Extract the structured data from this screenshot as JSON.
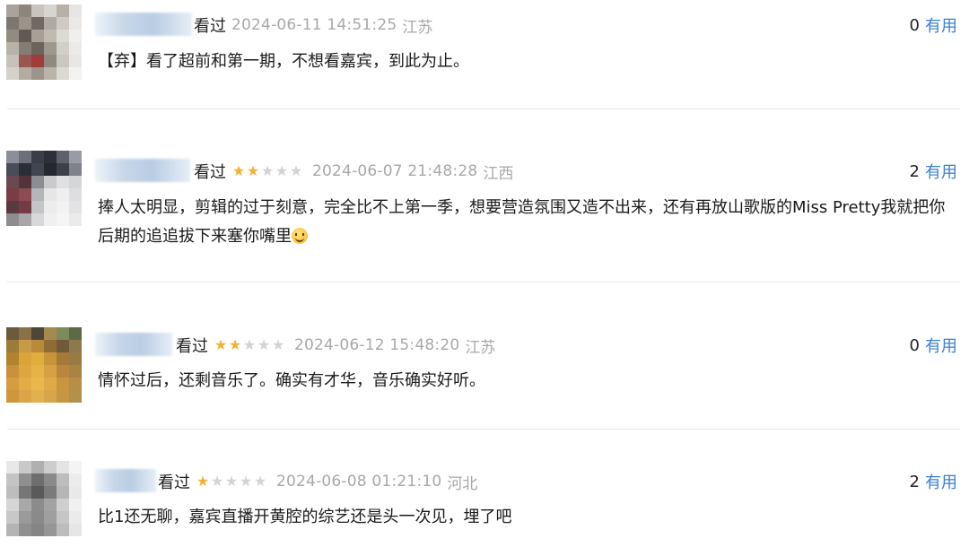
{
  "comments": [
    {
      "status": "看过",
      "rating": 0,
      "time": "2024-06-11 14:51:25",
      "location": "江苏",
      "useful_count": "0",
      "useful_label": "有用",
      "text": "【弃】看了超前和第一期，不想看嘉宾，到此为止。"
    },
    {
      "status": "看过",
      "rating": 2,
      "time": "2024-06-07 21:48:28",
      "location": "江西",
      "useful_count": "2",
      "useful_label": "有用",
      "text": "捧人太明显，剪辑的过于刻意，完全比不上第一季，想要营造氛围又造不出来，还有再放山歌版的Miss Pretty我就把你后期的追追拔下来塞你嘴里"
    },
    {
      "status": "看过",
      "rating": 2,
      "time": "2024-06-12 15:48:20",
      "location": "江苏",
      "useful_count": "0",
      "useful_label": "有用",
      "text": "情怀过后，还剩音乐了。确实有才华，音乐确实好听。"
    },
    {
      "status": "看过",
      "rating": 1,
      "time": "2024-06-08 01:21:10",
      "location": "河北",
      "useful_count": "2",
      "useful_label": "有用",
      "text": "比1还无聊，嘉宾直播开黄腔的综艺还是头一次见，埋了吧"
    }
  ],
  "colors": {
    "star_on": "#f2b134",
    "star_off": "#d3d3d3",
    "useful_link": "#3a7fd0",
    "meta_gray": "#a8a8a8"
  },
  "icons": {
    "star": "star-icon",
    "emoji": "smile-emoji-icon"
  }
}
